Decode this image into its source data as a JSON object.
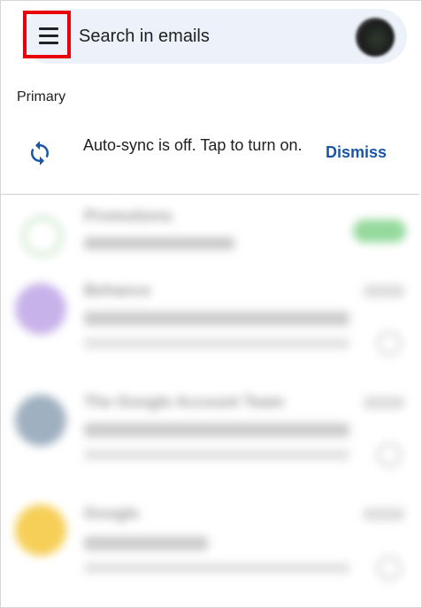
{
  "search": {
    "placeholder": "Search in emails"
  },
  "section": {
    "label": "Primary"
  },
  "banner": {
    "message": "Auto-sync is off. Tap to turn on.",
    "dismiss_label": "Dismiss",
    "icon": "sync-icon"
  },
  "emails": [
    {
      "sender": "Promotions",
      "snippet": "Aa"
    },
    {
      "sender": "Behance",
      "snippet": "Aa"
    },
    {
      "sender": "The Google Account Team",
      "snippet": "Aa"
    },
    {
      "sender": "Google",
      "snippet": "Aa"
    }
  ],
  "colors": {
    "accent": "#1a56a8",
    "highlight": "#e8000b",
    "search_bg": "#edf1fa",
    "avatar_purple": "#c8b2ea",
    "avatar_slate": "#9fb0c0",
    "avatar_yellow": "#f6cf57",
    "badge_green": "#7bcf83"
  }
}
